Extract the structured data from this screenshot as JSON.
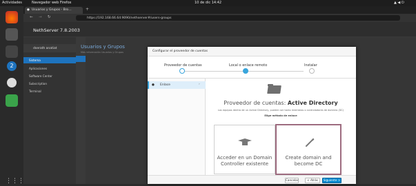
{
  "topbar": {
    "activities": "Actividades",
    "app": "Navegador web Firefox",
    "clock": "10 de dic 14:42"
  },
  "browser": {
    "tab_title": "Usuarios y Grupos - Bro…",
    "url": "https://192.168.66.64:9090/nethserver#/users-groups"
  },
  "app": {
    "title": "NethServer 7.8.2003"
  },
  "sidebar": {
    "host": "dserath anatiat",
    "items": [
      "Sistema",
      "Aplicaciones",
      "Software Center",
      "Subscription",
      "Terminal"
    ]
  },
  "main": {
    "title": "Usuarios y Grupos",
    "subtitle": "Más información Usuarios y Grupos"
  },
  "modal": {
    "header": "Configurar el proveedor de cuentas",
    "steps": [
      "Proveedor de cuentas",
      "Local o enlace remoto",
      "Instalar"
    ],
    "nav_item": "Enlace",
    "heading_prefix": "Proveedor de cuentas: ",
    "heading_bold": "Active Directory",
    "description": "Los equipos dentro de un Active Directory, pueden ser tanto miembros o controladores de dominio (DC)",
    "choose": "Elige método de enlace",
    "cards": [
      {
        "label": "Acceder en un Domain Controller existente",
        "icon": "graduation-cap-icon"
      },
      {
        "label": "Create domain and become DC",
        "icon": "magic-wand-icon"
      }
    ],
    "buttons": {
      "cancel": "Cancelar",
      "back": "< Atrás",
      "next": "Siguiente >"
    }
  }
}
